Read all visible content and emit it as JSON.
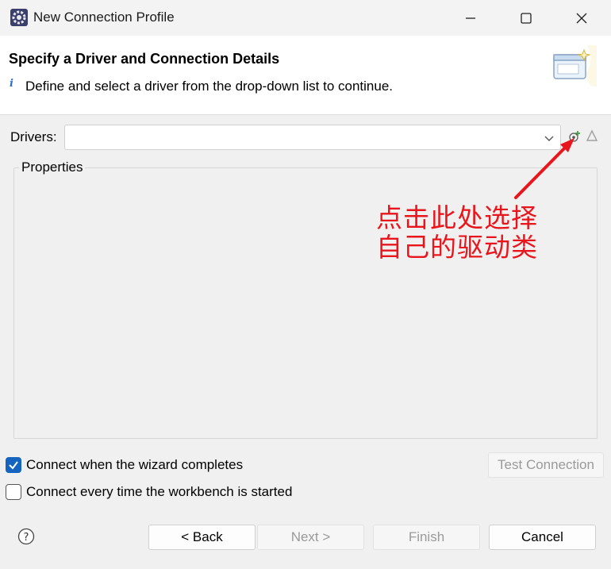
{
  "window": {
    "title": "New Connection Profile",
    "icons": {
      "app": "eclipse-gear-icon",
      "minimize": "minimize-icon",
      "maximize": "maximize-icon",
      "close": "close-icon"
    }
  },
  "header": {
    "title": "Specify a Driver and Connection Details",
    "description": "Define and select a driver from the drop-down list to continue.",
    "icons": {
      "info": "info-icon",
      "banner": "wizard-banner-icon"
    }
  },
  "drivers": {
    "label": "Drivers:",
    "value": "",
    "icons": {
      "dropdown": "chevron-down-icon",
      "new_driver": "new-driver-icon",
      "edit_driver": "edit-driver-icon"
    }
  },
  "properties": {
    "label": "Properties"
  },
  "annotation": {
    "line1": "点击此处选择",
    "line2": "自己的驱动类",
    "color": "#e8161c"
  },
  "options": {
    "connect_on_complete": {
      "label": "Connect when the wizard completes",
      "checked": true
    },
    "connect_on_startup": {
      "label": "Connect every time the workbench is started",
      "checked": false
    },
    "test_connection": "Test Connection"
  },
  "footer": {
    "help_icon": "help-icon",
    "back": "< Back",
    "next": "Next >",
    "finish": "Finish",
    "cancel": "Cancel"
  },
  "colors": {
    "accent": "#1565c0",
    "window_bg": "#f0f0f0",
    "header_bg": "#ffffff"
  }
}
